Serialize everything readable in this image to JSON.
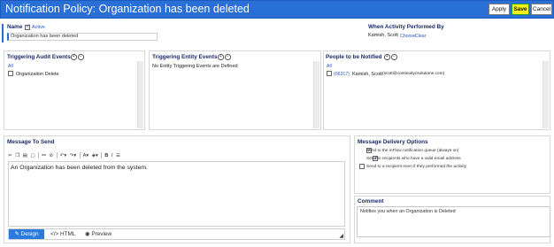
{
  "header": {
    "title": "Notification Policy: Organization has been deleted",
    "buttons": {
      "apply": "Apply",
      "save": "Save",
      "cancel": "Cancel"
    }
  },
  "name_section": {
    "label": "Name",
    "active_label": "Active",
    "value": "Organization has been deleted"
  },
  "activity": {
    "label": "When Activity Performed By",
    "person": "Kamish, Scott",
    "choose": "Choose",
    "clear": "Clear"
  },
  "audit": {
    "label": "Triggering Audit Events",
    "all": "All",
    "items": [
      "Organization Delete"
    ]
  },
  "entity": {
    "label": "Triggering Entity Events",
    "empty": "No Entity Triggering Events are Defined"
  },
  "people": {
    "label": "People to be Notified",
    "all": "All",
    "items": [
      {
        "id": "(06317)",
        "name": "Kamish, Scott",
        "email": "(scott@continuitycsolutions.com)"
      }
    ]
  },
  "message": {
    "label": "Message To Send",
    "body": "An Organization has been deleted from the system.",
    "modes": {
      "design": "Design",
      "html": "HTML",
      "preview": "Preview"
    }
  },
  "delivery": {
    "label": "Message Delivery Options",
    "options": [
      {
        "text": "Send to the inFlow notification queue (always on)",
        "checked": true
      },
      {
        "text": "Send to recipients who have a valid email address",
        "checked": true
      },
      {
        "text": "Send to a recipient even if they performed the activity",
        "checked": false
      }
    ]
  },
  "comment": {
    "label": "Comment",
    "value": "Notifies you when an Organization is Deleted"
  },
  "colors": {
    "accent": "#2a6fd6",
    "save_highlight": "#f4f41b",
    "header_text": "#1b2a66"
  }
}
